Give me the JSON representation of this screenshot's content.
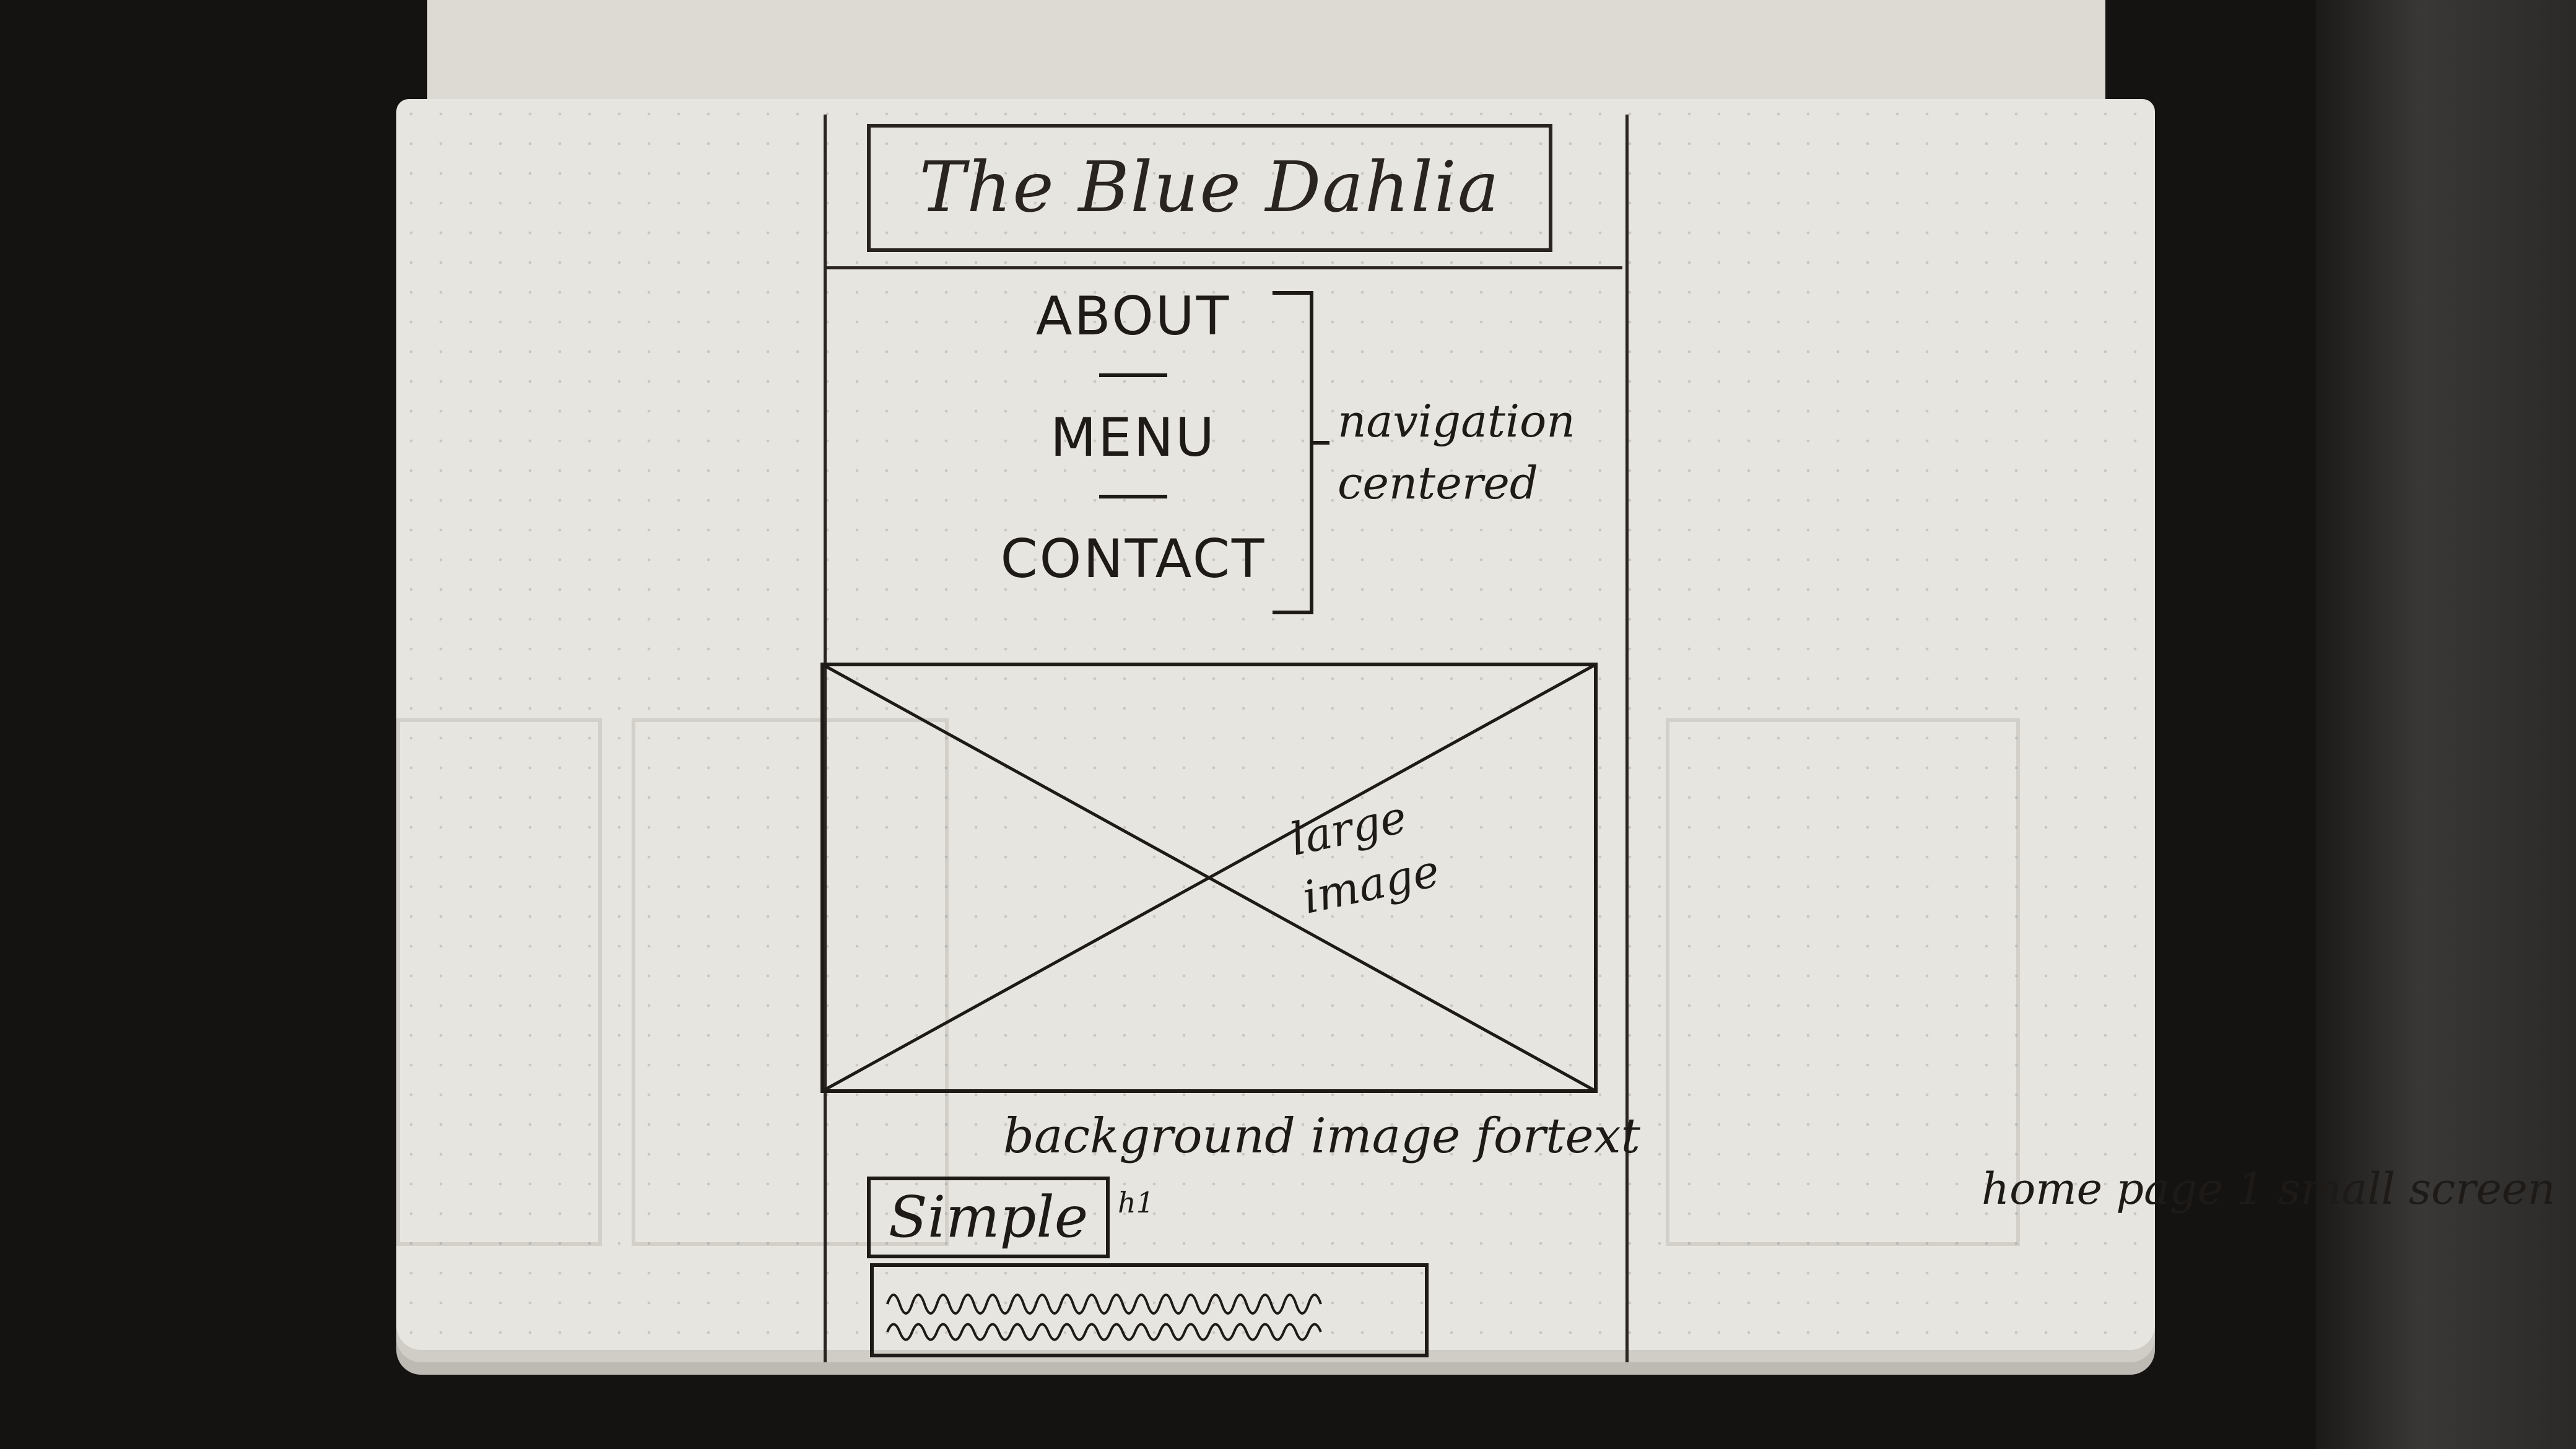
{
  "sketch": {
    "logo": "The Blue Dahlia",
    "nav": [
      "ABOUT",
      "MENU",
      "CONTACT"
    ],
    "nav_note": [
      "navigation",
      "centered"
    ],
    "image_note": [
      "large",
      "image"
    ],
    "background_note": "background image fortext",
    "button_label": "Simple",
    "button_note": "h1",
    "page_note": "home page 1 small screen"
  }
}
